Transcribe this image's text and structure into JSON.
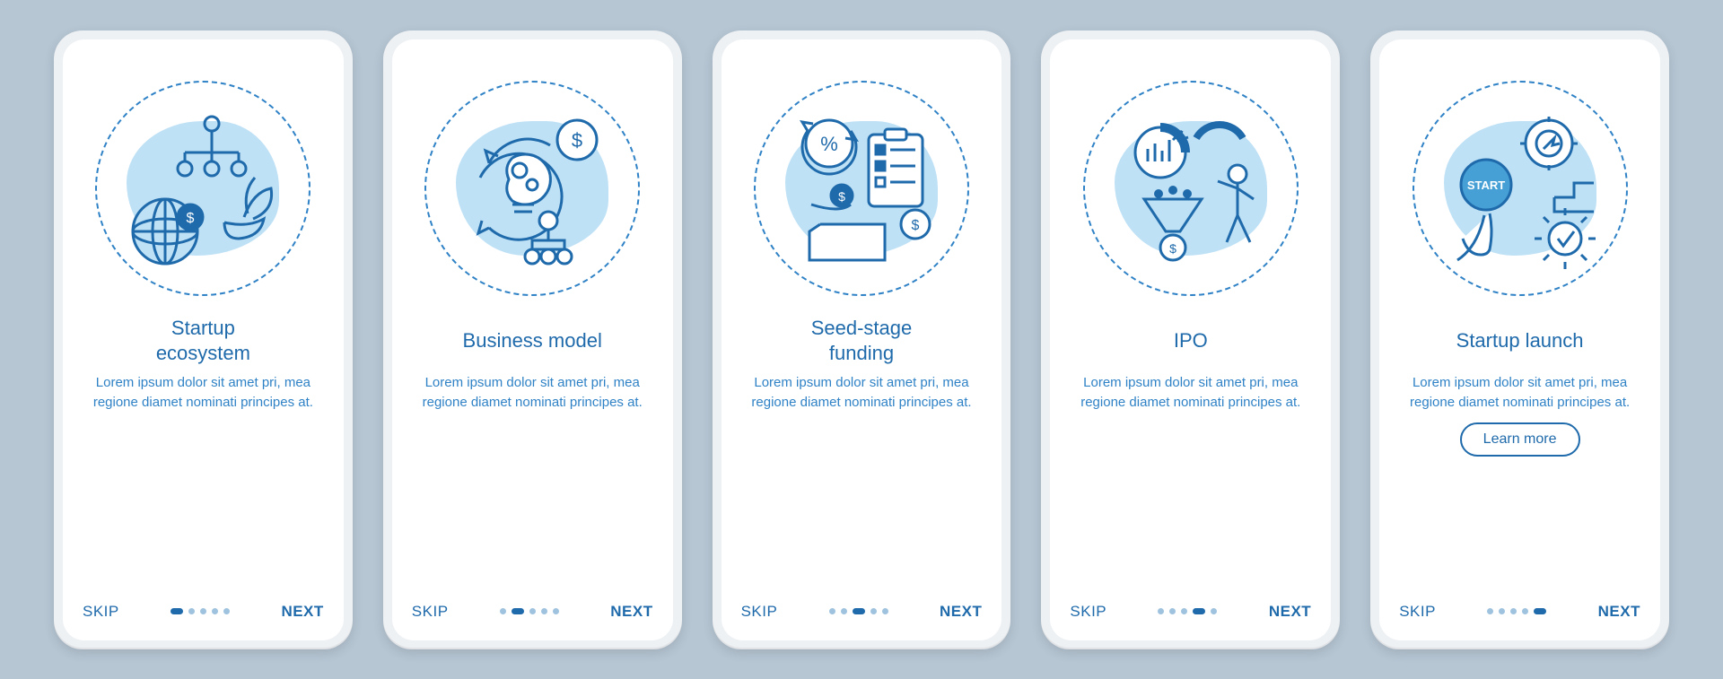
{
  "common": {
    "skip": "SKIP",
    "next": "NEXT",
    "learn_more": "Learn more",
    "desc": "Lorem ipsum dolor sit amet pri, mea regione diamet nominati principes at.",
    "total_steps": 5
  },
  "screens": [
    {
      "title": "Startup\necosystem",
      "icon_name": "startup-ecosystem-icon",
      "start_button_text": ""
    },
    {
      "title": "Business model",
      "icon_name": "business-model-icon",
      "start_button_text": ""
    },
    {
      "title": "Seed-stage\nfunding",
      "icon_name": "seed-funding-icon",
      "start_button_text": ""
    },
    {
      "title": "IPO",
      "icon_name": "ipo-icon",
      "start_button_text": ""
    },
    {
      "title": "Startup launch",
      "icon_name": "startup-launch-icon",
      "start_button_text": "START"
    }
  ]
}
